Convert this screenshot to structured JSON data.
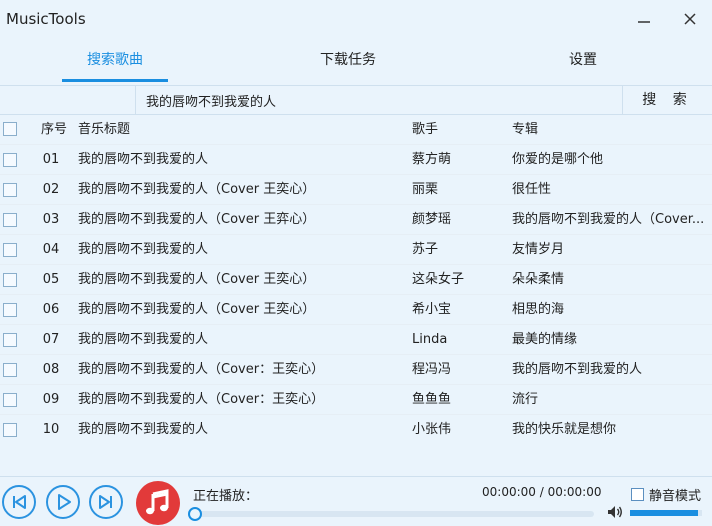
{
  "app": {
    "title": "MusicTools"
  },
  "tabs": [
    {
      "label": "搜索歌曲",
      "active": true
    },
    {
      "label": "下载任务",
      "active": false
    },
    {
      "label": "设置",
      "active": false
    }
  ],
  "search": {
    "value": "我的唇吻不到我爱的人",
    "button_label": "搜 索"
  },
  "table": {
    "headers": {
      "no": "序号",
      "title": "音乐标题",
      "artist": "歌手",
      "album": "专辑"
    },
    "rows": [
      {
        "no": "01",
        "title": "我的唇吻不到我爱的人",
        "artist": "蔡方萌",
        "album": "你爱的是哪个他"
      },
      {
        "no": "02",
        "title": "我的唇吻不到我爱的人（Cover 王奕心）",
        "artist": "丽栗",
        "album": "很任性"
      },
      {
        "no": "03",
        "title": "我的唇吻不到我爱的人（Cover 王弈心）",
        "artist": "颜梦瑶",
        "album": "我的唇吻不到我爱的人（Cover..."
      },
      {
        "no": "04",
        "title": "我的唇吻不到我爱的人",
        "artist": "苏子",
        "album": "友情岁月"
      },
      {
        "no": "05",
        "title": "我的唇吻不到我爱的人（Cover 王奕心）",
        "artist": "这朵女子",
        "album": "朵朵柔情"
      },
      {
        "no": "06",
        "title": "我的唇吻不到我爱的人（Cover 王奕心）",
        "artist": "希小宝",
        "album": "相思的海"
      },
      {
        "no": "07",
        "title": "我的唇吻不到我爱的人",
        "artist": "Linda",
        "album": "最美的情缘"
      },
      {
        "no": "08",
        "title": "我的唇吻不到我爱的人（Cover：王奕心）",
        "artist": "程冯冯",
        "album": "我的唇吻不到我爱的人"
      },
      {
        "no": "09",
        "title": "我的唇吻不到我爱的人（Cover：王奕心）",
        "artist": "鱼鱼鱼",
        "album": "流行"
      },
      {
        "no": "10",
        "title": "我的唇吻不到我爱的人",
        "artist": "小张伟",
        "album": "我的快乐就是想你"
      }
    ]
  },
  "player": {
    "now_playing_label": "正在播放：",
    "time": "00:00:00 / 00:00:00",
    "progress": 0,
    "volume": 0.95,
    "mute_label": "静音模式",
    "mute_checked": false
  },
  "colors": {
    "accent": "#1a8ee0",
    "music_icon_bg": "#e23a3a",
    "background": "#eaf4fc"
  },
  "icons": {
    "minimize": "minimize-icon",
    "close": "close-icon",
    "prev": "skip-previous-icon",
    "play": "play-icon",
    "next": "skip-next-icon",
    "music": "music-note-icon",
    "volume": "speaker-icon"
  }
}
